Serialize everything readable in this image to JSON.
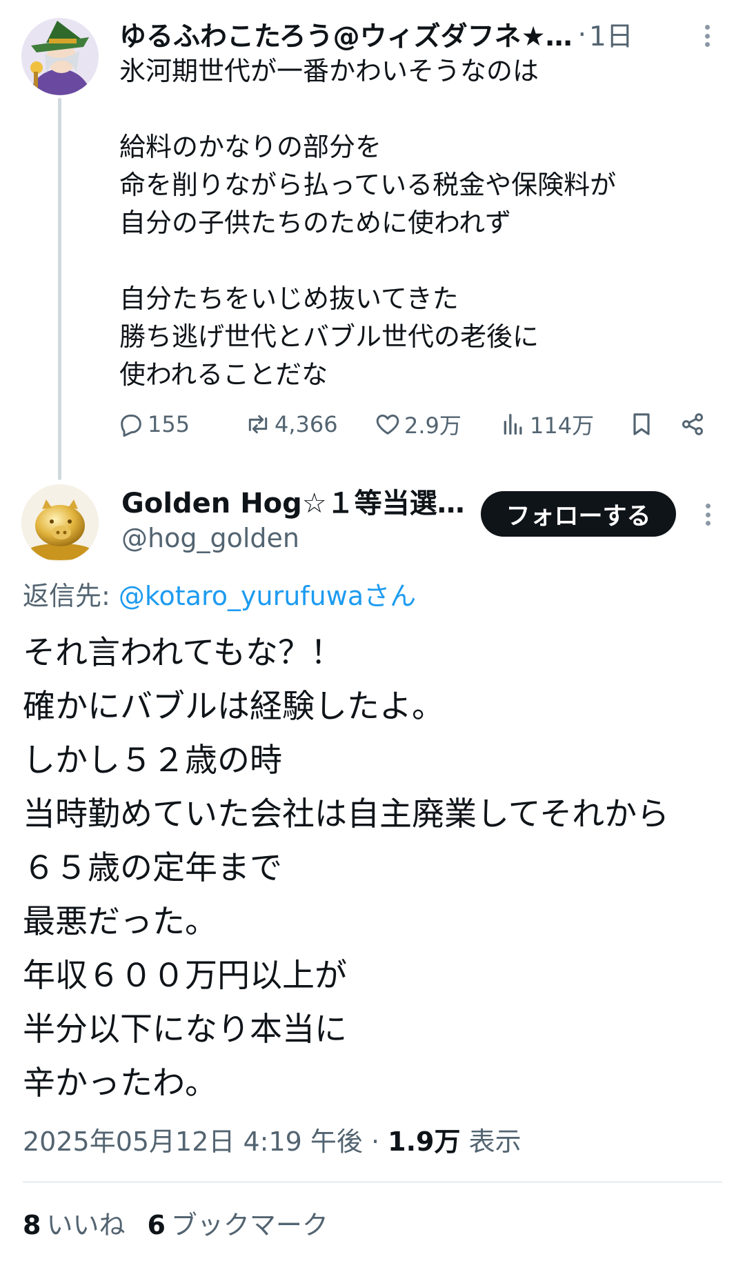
{
  "parent_tweet": {
    "display_name": "ゆるふわこたろう@ウィズダフネ★…",
    "separator": "·",
    "time": "1日",
    "lines": [
      "氷河期世代が一番かわいそうなのは",
      "",
      "給料のかなりの部分を",
      "命を削りながら払っている税金や保険料が",
      "自分の子供たちのために使われず",
      "",
      "自分たちをいじめ抜いてきた",
      "勝ち逃げ世代とバブル世代の老後に",
      "使われることだな"
    ],
    "actions": {
      "replies": "155",
      "retweets": "4,366",
      "likes": "2.9万",
      "views": "114万"
    }
  },
  "reply_tweet": {
    "display_name": "Golden Hog☆１等当選…",
    "handle": "@hog_golden",
    "follow_label": "フォローする",
    "reply_to_prefix": "返信先: ",
    "reply_to_mention": "@kotaro_yurufuwaさん",
    "lines": [
      "それ言われてもな？！",
      "確かにバブルは経験したよ。",
      "しかし５２歳の時",
      "当時勤めていた会社は自主廃業してそれから",
      "６５歳の定年まで",
      "最悪だった。",
      "年収６００万円以上が",
      "半分以下になり本当に",
      "辛かったわ。"
    ],
    "timestamp": "2025年05月12日 4:19 午後",
    "meta_separator": " · ",
    "views_count": "1.9万",
    "views_label": " 表示",
    "likes_count": "8",
    "likes_label": "いいね",
    "bookmarks_count": "6",
    "bookmarks_label": "ブックマーク"
  },
  "icons": {
    "reply": "reply-icon",
    "retweet": "retweet-icon",
    "like": "heart-icon",
    "views": "views-icon",
    "bookmark": "bookmark-icon",
    "share": "share-icon",
    "more": "more-icon"
  },
  "colors": {
    "text": "#0f1419",
    "secondary": "#536471",
    "link": "#1d9bf0",
    "follow_button": "#0f1419"
  }
}
